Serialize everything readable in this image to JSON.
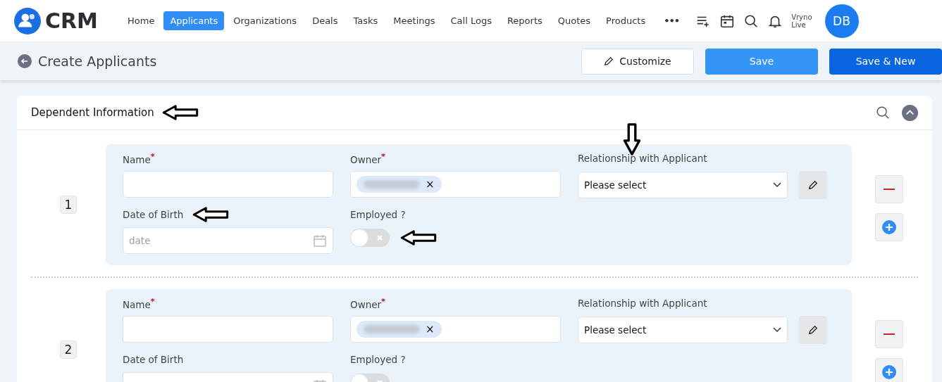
{
  "brand": {
    "name": "CRM"
  },
  "nav": [
    {
      "label": "Home",
      "selected": false
    },
    {
      "label": "Applicants",
      "selected": true
    },
    {
      "label": "Organizations",
      "selected": false
    },
    {
      "label": "Deals",
      "selected": false
    },
    {
      "label": "Tasks",
      "selected": false
    },
    {
      "label": "Meetings",
      "selected": false
    },
    {
      "label": "Call Logs",
      "selected": false
    },
    {
      "label": "Reports",
      "selected": false
    },
    {
      "label": "Quotes",
      "selected": false
    },
    {
      "label": "Products",
      "selected": false
    }
  ],
  "more": "•••",
  "user": {
    "org_line_1": "Vryno",
    "org_line_2": "Live",
    "initials": "DB"
  },
  "page": {
    "title": "Create Applicants",
    "buttons": [
      {
        "label": "Customize",
        "kind": "outline"
      },
      {
        "label": "Save",
        "kind": "primary"
      },
      {
        "label": "Save & New",
        "kind": "dark"
      }
    ]
  },
  "section": {
    "title": "Dependent Information",
    "expanded": true
  },
  "dependents": [
    {
      "number": "1",
      "annotated": true,
      "fields": [
        {
          "kind": "text",
          "label": "Name$^{*}$"
        },
        {
          "kind": "owner",
          "label": "Owner$^{*}$",
          "chip_remove": "×"
        },
        {
          "kind": "select",
          "label": "Relationship with Applicant",
          "value": "Please select"
        },
        {
          "kind": "date",
          "label": "Date of Birth",
          "placeholder": "date"
        },
        {
          "kind": "toggle",
          "label": "Employed ?",
          "on": false
        }
      ]
    },
    {
      "number": "2",
      "annotated": false,
      "fields": [
        {
          "kind": "text",
          "label": "Name$^{*}$"
        },
        {
          "kind": "owner",
          "label": "Owner$^{*}$",
          "chip_remove": "×"
        },
        {
          "kind": "select",
          "label": "Relationship with Applicant",
          "value": "Please select"
        },
        {
          "kind": "date",
          "label": "Date of Birth"
        },
        {
          "kind": "toggle",
          "label": "Employed ?"
        }
      ]
    }
  ]
}
